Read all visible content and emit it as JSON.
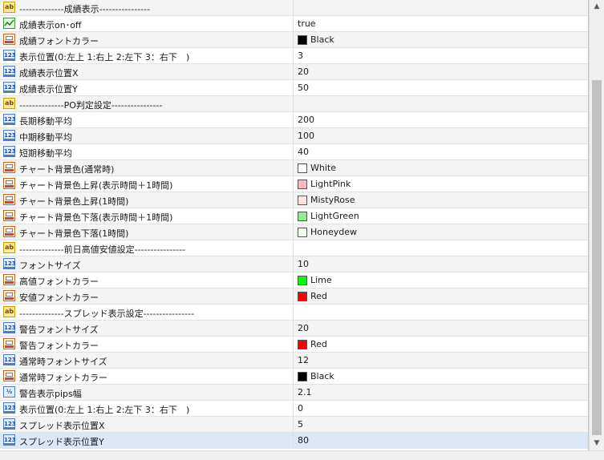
{
  "properties": [
    {
      "icon": "ab",
      "name": "--------------成績表示----------------",
      "value": ""
    },
    {
      "icon": "bool",
      "name": "成績表示on･off",
      "value": "true"
    },
    {
      "icon": "color",
      "name": "成績フォントカラー",
      "value": "Black",
      "swatch": "#000000"
    },
    {
      "icon": "num",
      "name": "表示位置(0:左上 1:右上 2:左下 3：右下　)",
      "value": "3"
    },
    {
      "icon": "num",
      "name": "成績表示位置X",
      "value": "20"
    },
    {
      "icon": "num",
      "name": "成績表示位置Y",
      "value": "50"
    },
    {
      "icon": "ab",
      "name": "--------------PO判定設定----------------",
      "value": ""
    },
    {
      "icon": "num",
      "name": "長期移動平均",
      "value": "200"
    },
    {
      "icon": "num",
      "name": "中期移動平均",
      "value": "100"
    },
    {
      "icon": "num",
      "name": "短期移動平均",
      "value": "40"
    },
    {
      "icon": "color",
      "name": "チャート背景色(通常時)",
      "value": "White",
      "swatch": "#ffffff"
    },
    {
      "icon": "color",
      "name": "チャート背景色上昇(表示時間＋1時間)",
      "value": "LightPink",
      "swatch": "#ffb6c1"
    },
    {
      "icon": "color",
      "name": "チャート背景色上昇(1時間)",
      "value": "MistyRose",
      "swatch": "#ffe4e1"
    },
    {
      "icon": "color",
      "name": "チャート背景色下落(表示時間＋1時間)",
      "value": "LightGreen",
      "swatch": "#90ee90"
    },
    {
      "icon": "color",
      "name": "チャート背景色下落(1時間)",
      "value": "Honeydew",
      "swatch": "#f0fff0"
    },
    {
      "icon": "ab",
      "name": "--------------前日高値安値設定----------------",
      "value": ""
    },
    {
      "icon": "num",
      "name": "フォントサイズ",
      "value": "10"
    },
    {
      "icon": "color",
      "name": "高値フォントカラー",
      "value": "Lime",
      "swatch": "#00ff00"
    },
    {
      "icon": "color",
      "name": "安値フォントカラー",
      "value": "Red",
      "swatch": "#ff0000"
    },
    {
      "icon": "ab",
      "name": "--------------スプレッド表示設定----------------",
      "value": ""
    },
    {
      "icon": "num",
      "name": "警告フォントサイズ",
      "value": "20"
    },
    {
      "icon": "color",
      "name": "警告フォントカラー",
      "value": "Red",
      "swatch": "#ff0000"
    },
    {
      "icon": "num",
      "name": "通常時フォントサイズ",
      "value": "12"
    },
    {
      "icon": "color",
      "name": "通常時フォントカラー",
      "value": "Black",
      "swatch": "#000000"
    },
    {
      "icon": "frac",
      "name": "警告表示pips幅",
      "value": "2.1"
    },
    {
      "icon": "num",
      "name": "表示位置(0:左上 1:右上 2:左下 3：右下　)",
      "value": "0"
    },
    {
      "icon": "num",
      "name": "スプレッド表示位置X",
      "value": "5"
    },
    {
      "icon": "num",
      "name": "スプレッド表示位置Y",
      "value": "80",
      "selected": true
    }
  ],
  "icon_glyphs": {
    "ab": "ab",
    "num": "123",
    "frac": "½",
    "bool": "✓",
    "color": ""
  },
  "scroll": {
    "up": "▲",
    "down": "▼"
  }
}
